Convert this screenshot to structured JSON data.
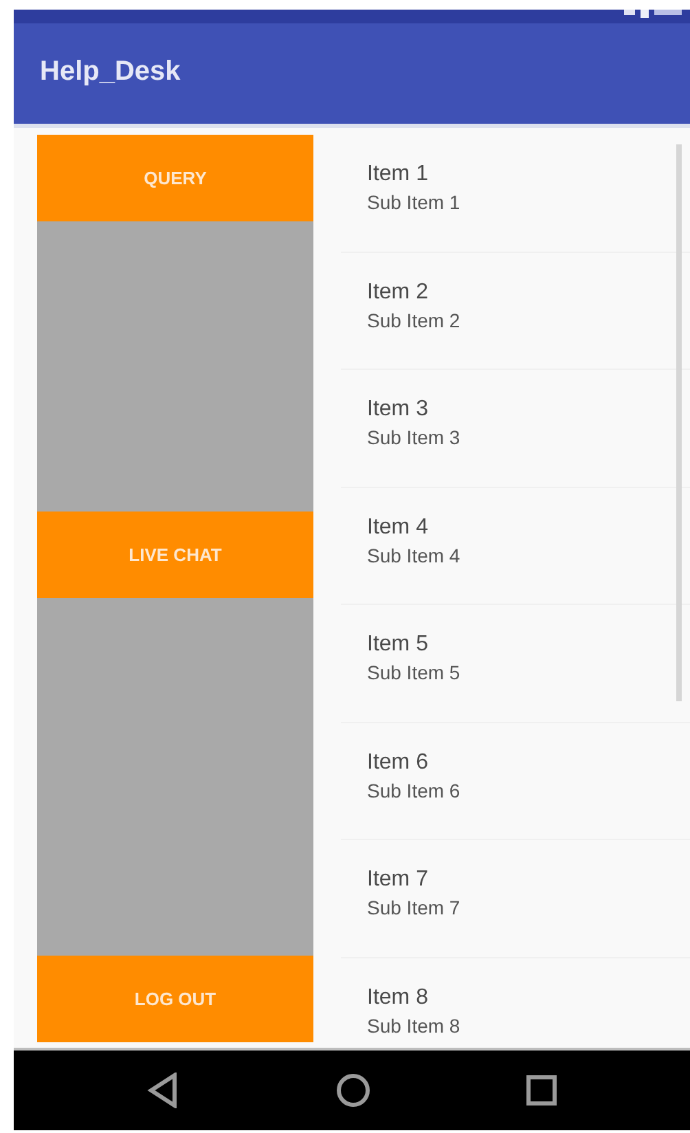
{
  "app_bar": {
    "title": "Help_Desk"
  },
  "menu": [
    {
      "label": "QUERY"
    },
    {
      "label": "LIVE CHAT"
    },
    {
      "label": "LOG OUT"
    }
  ],
  "list": [
    {
      "title": "Item 1",
      "subtitle": "Sub Item 1"
    },
    {
      "title": "Item 2",
      "subtitle": "Sub Item 2"
    },
    {
      "title": "Item 3",
      "subtitle": "Sub Item 3"
    },
    {
      "title": "Item 4",
      "subtitle": "Sub Item 4"
    },
    {
      "title": "Item 5",
      "subtitle": "Sub Item 5"
    },
    {
      "title": "Item 6",
      "subtitle": "Sub Item 6"
    },
    {
      "title": "Item 7",
      "subtitle": "Sub Item 7"
    },
    {
      "title": "Item 8",
      "subtitle": "Sub Item 8"
    }
  ]
}
